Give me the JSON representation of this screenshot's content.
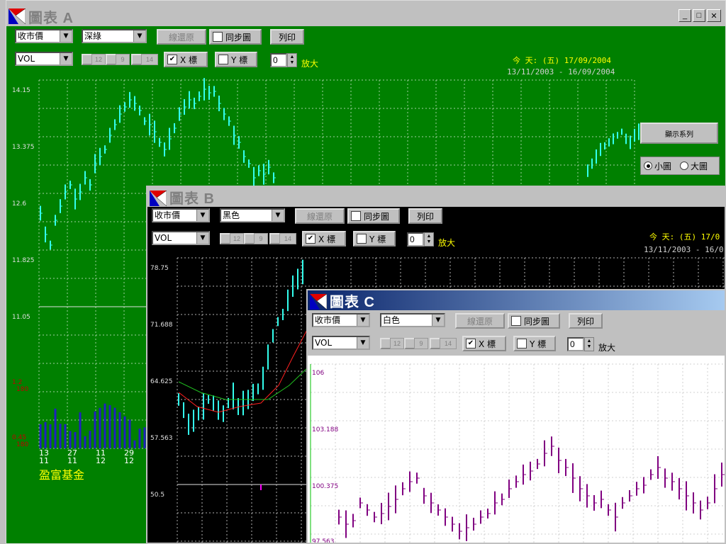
{
  "colors": {
    "winA_bg": "#008000",
    "winB_bg": "#000000",
    "winC_bg": "#ffffff",
    "price_cyan": "#33ffee",
    "price_purple": "#800080",
    "titlebar_A": "#c0c0c0",
    "titlebar_C": "#0a246a"
  },
  "windowA": {
    "title": "圖表 A",
    "price_select": "收市價",
    "theme_select": "深綠",
    "restore_label": "線還原",
    "sync_label": "同步圖",
    "print_label": "列印",
    "indicator_select": "VOL",
    "mini_labels": [
      "12",
      "9",
      "14"
    ],
    "x_axis_label": "X 標",
    "y_axis_label": "Y 標",
    "zoom_value": "0",
    "zoom_label": "放大",
    "today_text": "今 天: (五) 17/09/2004",
    "range_text": "13/11/2003 - 16/09/2004",
    "y_ticks": [
      "14.15",
      "13.375",
      "12.6",
      "11.825",
      "11.05"
    ],
    "vol_labels_top": [
      "1.2",
      "180"
    ],
    "vol_labels_bot": [
      "0.45",
      "180"
    ],
    "x_ticks": [
      [
        "13",
        "11"
      ],
      [
        "27",
        "11"
      ],
      [
        "11",
        "12"
      ],
      [
        "29",
        "12"
      ]
    ],
    "fund_name": "盈富基金",
    "side_button": "顯示系列",
    "radio_small": "小圖",
    "radio_large": "大圖"
  },
  "windowB": {
    "title": "圖表 B",
    "price_select": "收市價",
    "theme_select": "黑色",
    "restore_label": "線還原",
    "sync_label": "同步圖",
    "print_label": "列印",
    "indicator_select": "VOL",
    "mini_labels": [
      "12",
      "9",
      "14"
    ],
    "x_axis_label": "X 標",
    "y_axis_label": "Y 標",
    "zoom_value": "0",
    "zoom_label": "放大",
    "today_text": "今 天: (五) 17/0",
    "range_text": "13/11/2003 - 16/0",
    "y_ticks": [
      "78.75",
      "71.688",
      "64.625",
      "57.563",
      "50.5"
    ]
  },
  "windowC": {
    "title": "圖表 C",
    "price_select": "收市價",
    "theme_select": "白色",
    "restore_label": "線還原",
    "sync_label": "同步圖",
    "print_label": "列印",
    "indicator_select": "VOL",
    "mini_labels": [
      "12",
      "9",
      "14"
    ],
    "x_axis_label": "X 標",
    "y_axis_label": "Y 標",
    "zoom_value": "0",
    "zoom_label": "放大",
    "y_ticks": [
      "106",
      "103.188",
      "100.375",
      "97.563"
    ]
  }
}
